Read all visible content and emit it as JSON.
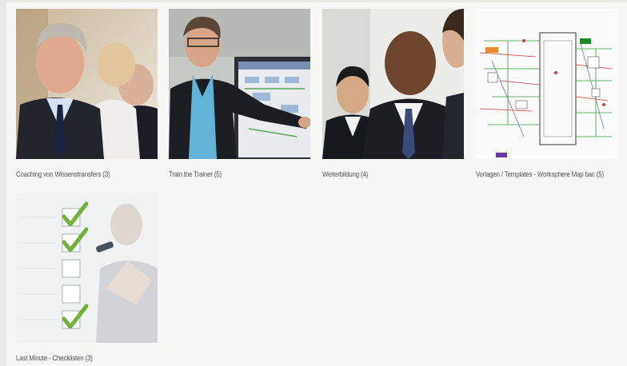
{
  "gallery": {
    "items": [
      {
        "label": "Coaching von Wissenstransfers (3)",
        "image": "business-team-photo"
      },
      {
        "label": "Train the Trainer (5)",
        "image": "trainer-presenting-photo"
      },
      {
        "label": "Weiterbildung (4)",
        "image": "businessmen-discussion-photo"
      },
      {
        "label": "Vorlagen / Templates - Worksphere Map bac (5)",
        "image": "process-map-diagram"
      },
      {
        "label": "Last Minute - Checklisten (3)",
        "image": "checklist-photo"
      }
    ]
  },
  "colors": {
    "background": "#e9e9e6",
    "panel": "#f7f7f6",
    "caption_text": "#555555",
    "check_green": "#6fb33a"
  }
}
